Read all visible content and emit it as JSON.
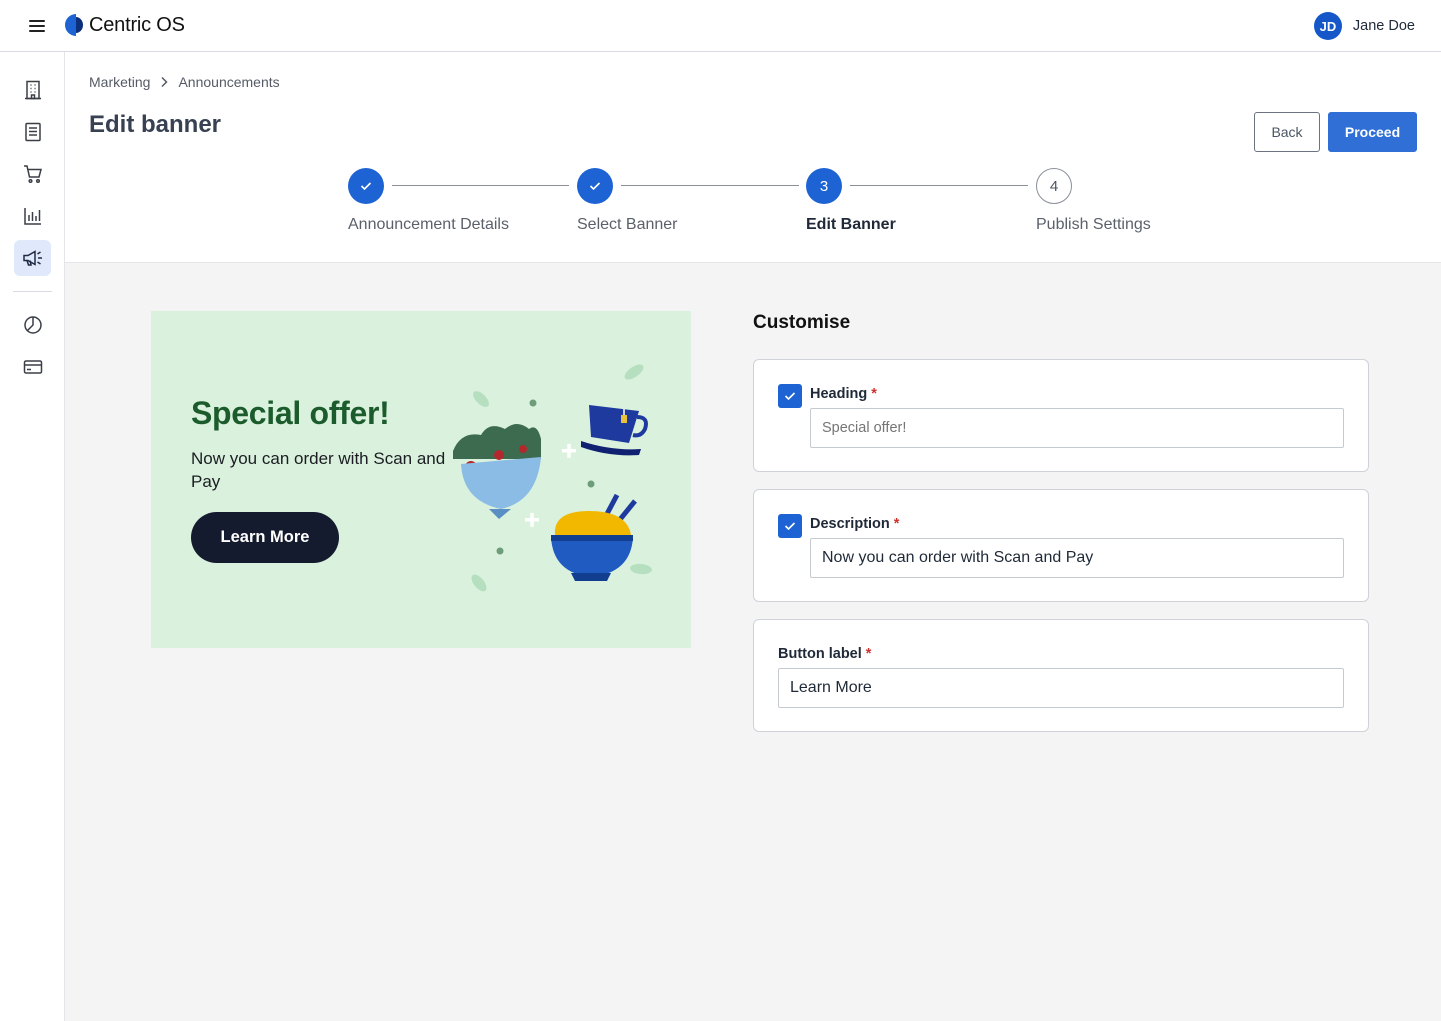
{
  "app": {
    "name": "Centric OS",
    "user": {
      "initials": "JD",
      "name": "Jane Doe"
    }
  },
  "sidebar": {
    "items": [
      {
        "icon": "building-icon"
      },
      {
        "icon": "document-icon"
      },
      {
        "icon": "cart-icon"
      },
      {
        "icon": "bar-chart-icon"
      },
      {
        "icon": "megaphone-icon",
        "active": true
      },
      {
        "icon": "pie-chart-icon"
      },
      {
        "icon": "credit-card-icon"
      }
    ]
  },
  "breadcrumb": [
    "Marketing",
    "Announcements"
  ],
  "page": {
    "title": "Edit banner",
    "back_label": "Back",
    "proceed_label": "Proceed"
  },
  "stepper": {
    "steps": [
      {
        "number": "1",
        "label": "Announcement Details",
        "state": "done"
      },
      {
        "number": "2",
        "label": "Select Banner",
        "state": "done"
      },
      {
        "number": "3",
        "label": "Edit Banner",
        "state": "current"
      },
      {
        "number": "4",
        "label": "Publish Settings",
        "state": "upcoming"
      }
    ]
  },
  "banner": {
    "heading": "Special offer!",
    "description": "Now you can order with Scan and Pay",
    "button": "Learn More",
    "background": "#d9f1dd",
    "heading_color": "#1c5b2c"
  },
  "customise": {
    "title": "Customise",
    "heading": {
      "label": "Heading",
      "required": "*",
      "placeholder": "Special offer!",
      "value": "",
      "checked": true
    },
    "description": {
      "label": "Description",
      "required": "*",
      "placeholder": "",
      "value": "Now you can order with Scan and Pay",
      "checked": true
    },
    "button_label": {
      "label": "Button label",
      "required": "*",
      "placeholder": "",
      "value": "Learn More"
    }
  },
  "colors": {
    "accent": "#2f6fd6",
    "step_active": "#1d63d4",
    "required": "#d0312d"
  }
}
